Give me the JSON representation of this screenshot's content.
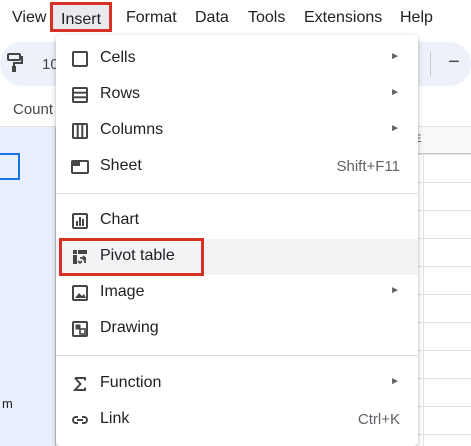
{
  "menubar": {
    "view": "View",
    "insert": "Insert",
    "format": "Format",
    "data": "Data",
    "tools": "Tools",
    "extensions": "Extensions",
    "help": "Help"
  },
  "toolbar": {
    "paint_format_icon": "paint-format-icon",
    "zoom_partial": "10",
    "minus_label": "−"
  },
  "namebox": {
    "text": "Count"
  },
  "grid": {
    "column_label_partial": "E",
    "cell_partial_text": "m"
  },
  "insert_menu": {
    "items": [
      {
        "label": "Cells",
        "icon": "cells-icon",
        "submenu": true
      },
      {
        "label": "Rows",
        "icon": "rows-icon",
        "submenu": true
      },
      {
        "label": "Columns",
        "icon": "columns-icon",
        "submenu": true
      },
      {
        "label": "Sheet",
        "icon": "sheet-icon",
        "shortcut": "Shift+F11"
      },
      {
        "label": "Chart",
        "icon": "chart-icon"
      },
      {
        "label": "Pivot table",
        "icon": "pivot-table-icon",
        "highlighted": true
      },
      {
        "label": "Image",
        "icon": "image-icon",
        "submenu": true
      },
      {
        "label": "Drawing",
        "icon": "drawing-icon"
      },
      {
        "label": "Function",
        "icon": "function-icon",
        "submenu": true
      },
      {
        "label": "Link",
        "icon": "link-icon",
        "shortcut": "Ctrl+K"
      }
    ],
    "submenu_arrow": "►"
  },
  "colors": {
    "highlight_outline": "#d93025",
    "selection_blue": "#1a73e8",
    "toolbar_bg": "#edf2fa",
    "hover_bg": "#f1f3f4"
  }
}
